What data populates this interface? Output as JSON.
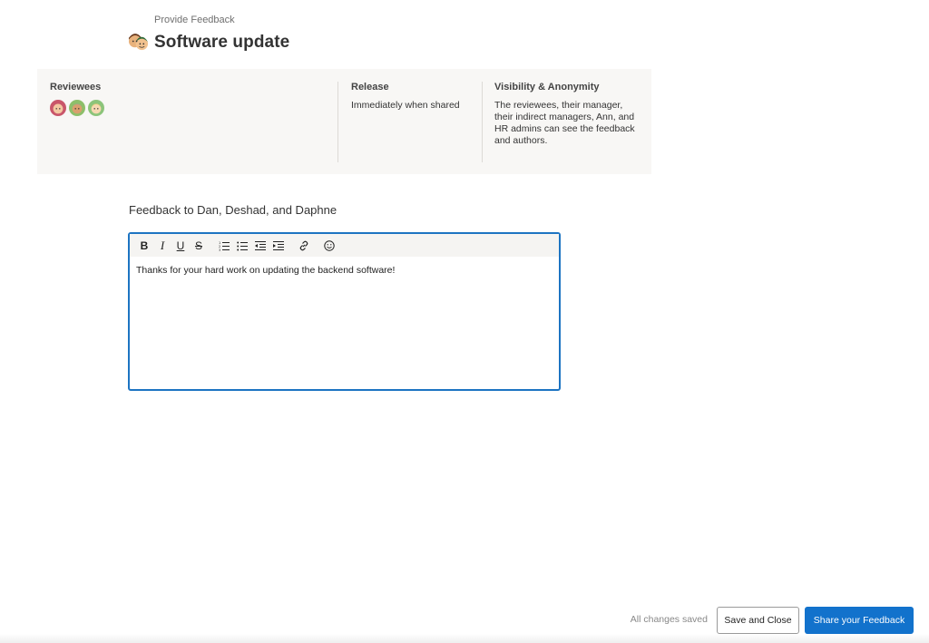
{
  "header": {
    "breadcrumb": "Provide Feedback",
    "title": "Software update"
  },
  "info": {
    "reviewees_label": "Reviewees",
    "reviewees_avatars": [
      "avatar-dan",
      "avatar-deshad",
      "avatar-daphne"
    ],
    "release_label": "Release",
    "release_value": "Immediately when shared",
    "visibility_label": "Visibility & Anonymity",
    "visibility_value": "The reviewees, their manager, their indirect managers, Ann, and HR admins can see the feedback and authors."
  },
  "feedback": {
    "heading": "Feedback to Dan, Deshad, and Daphne",
    "toolbar": {
      "bold": "B",
      "italic": "I",
      "underline": "U",
      "strikethrough": "S",
      "icons": [
        "numbered-list-icon",
        "bullet-list-icon",
        "outdent-icon",
        "indent-icon",
        "link-icon",
        "emoji-icon"
      ]
    },
    "content": "Thanks for your hard work on updating the backend software!"
  },
  "footer": {
    "status": "All changes saved",
    "save_label": "Save and Close",
    "share_label": "Share your Feedback"
  },
  "colors": {
    "accent": "#1272cc",
    "editor_border": "#1d74c2",
    "panel_bg": "#f8f7f5"
  }
}
